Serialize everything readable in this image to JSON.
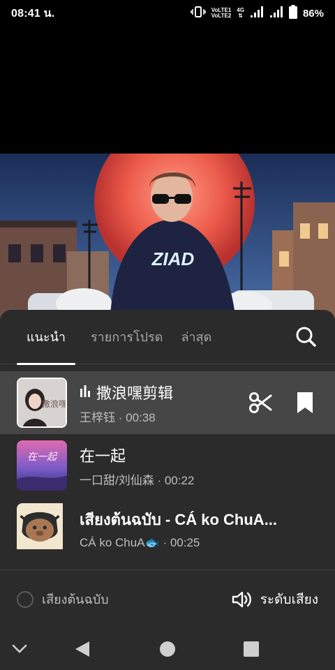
{
  "status_bar": {
    "time": "08:41 น.",
    "volte1": "VoLTE1",
    "volte2": "VoLTE2",
    "network": "4G",
    "battery": "86%"
  },
  "video": {
    "hoodie_text": "ZIAD"
  },
  "tabs": [
    {
      "label": "แนะนำ",
      "active": true
    },
    {
      "label": "รายการโปรด",
      "active": false
    },
    {
      "label": "ล่าสุด",
      "active": false
    }
  ],
  "songs": [
    {
      "title": "撒浪嘿剪辑",
      "artist": "王梓钰",
      "duration": "00:38",
      "selected": true,
      "thumb_text": "撒浪嘿"
    },
    {
      "title": "在一起",
      "artist": "一口甜/刘仙森",
      "duration": "00:22",
      "selected": false,
      "thumb_text": "在一起"
    },
    {
      "title": "เสียงต้นฉบับ - CÁ ko ChuA...",
      "artist": "CÁ ko ChuA🐟",
      "duration": "00:25",
      "selected": false
    }
  ],
  "footer": {
    "original_sound_label": "เสียงต้นฉบับ",
    "volume_label": "ระดับเสียง"
  },
  "icons": {
    "search": "search-icon",
    "scissors": "scissors-icon",
    "bookmark": "bookmark-icon",
    "volume": "volume-icon",
    "playing": "playing-bars-icon"
  }
}
